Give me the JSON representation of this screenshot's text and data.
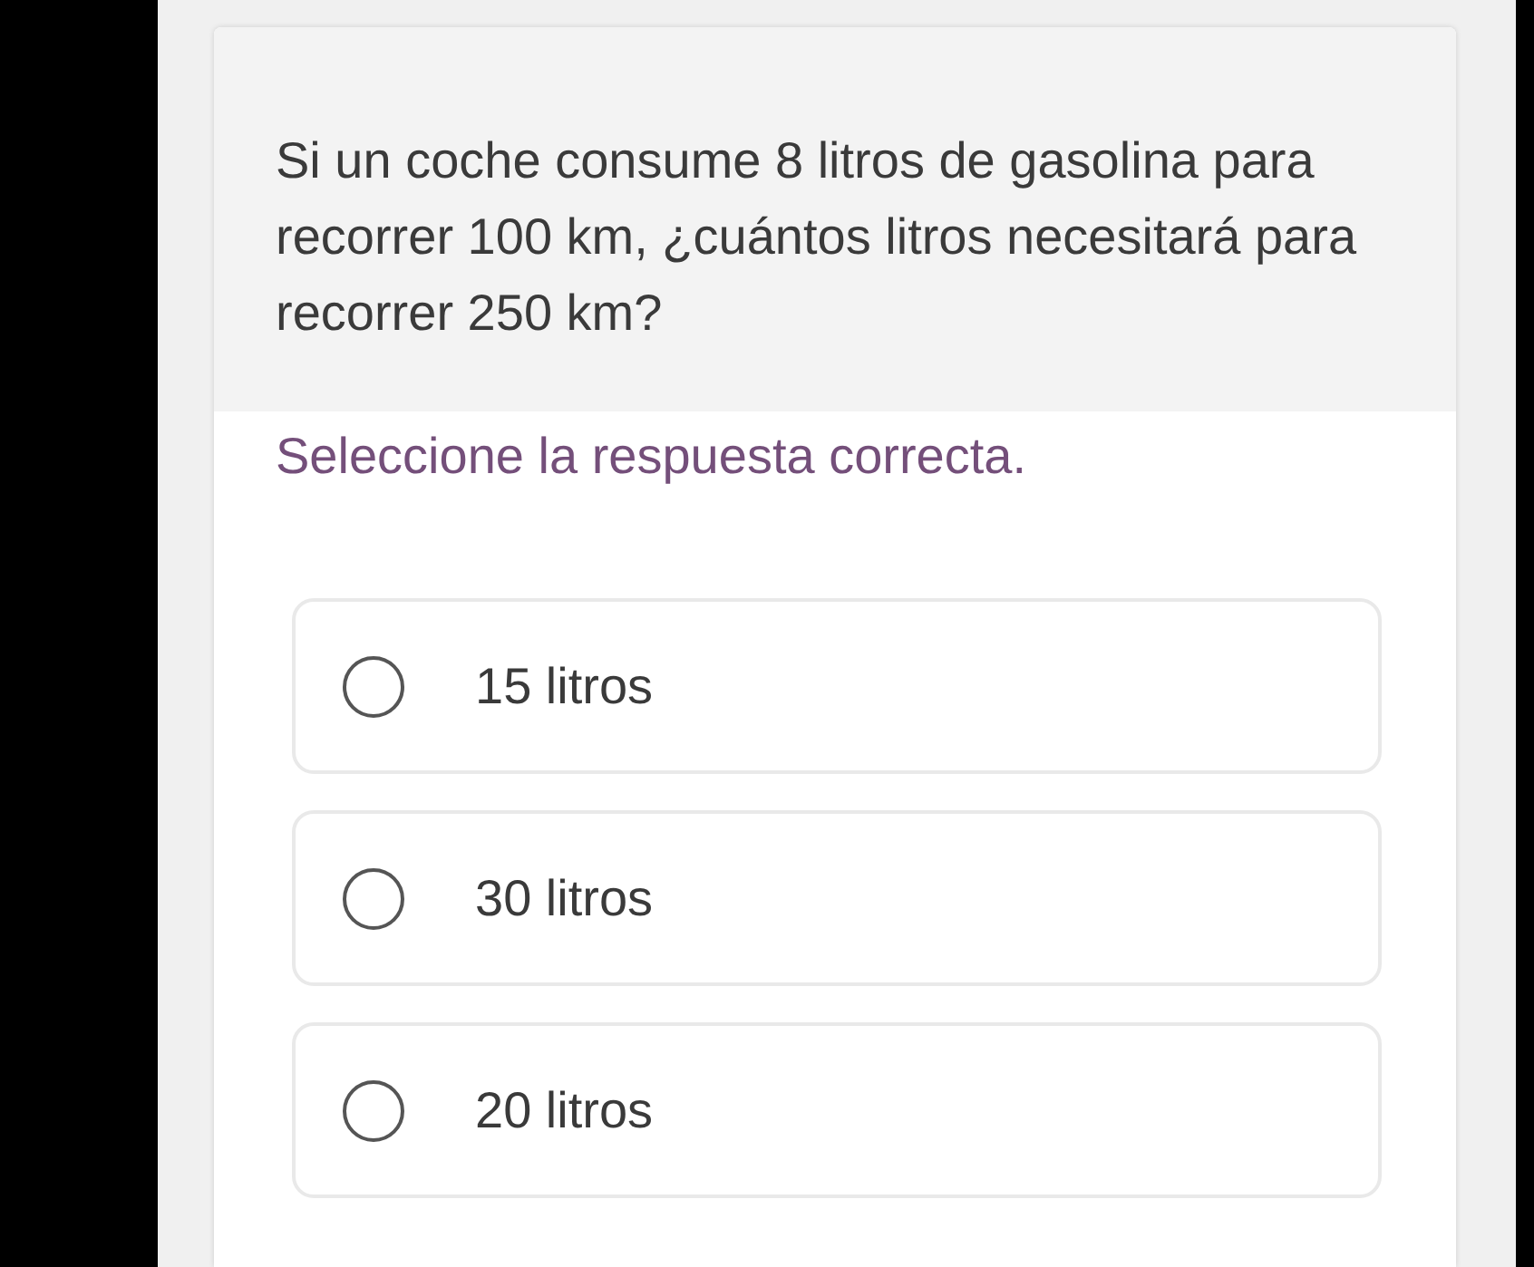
{
  "question": {
    "text": "Si un coche consume 8 litros de gasolina para recorrer 100 km, ¿cuántos litros necesitará para recorrer 250 km?"
  },
  "instruction": "Seleccione la respuesta correcta.",
  "options": [
    {
      "label": "15 litros",
      "selected": false
    },
    {
      "label": "30 litros",
      "selected": false
    },
    {
      "label": "20 litros",
      "selected": false
    }
  ]
}
